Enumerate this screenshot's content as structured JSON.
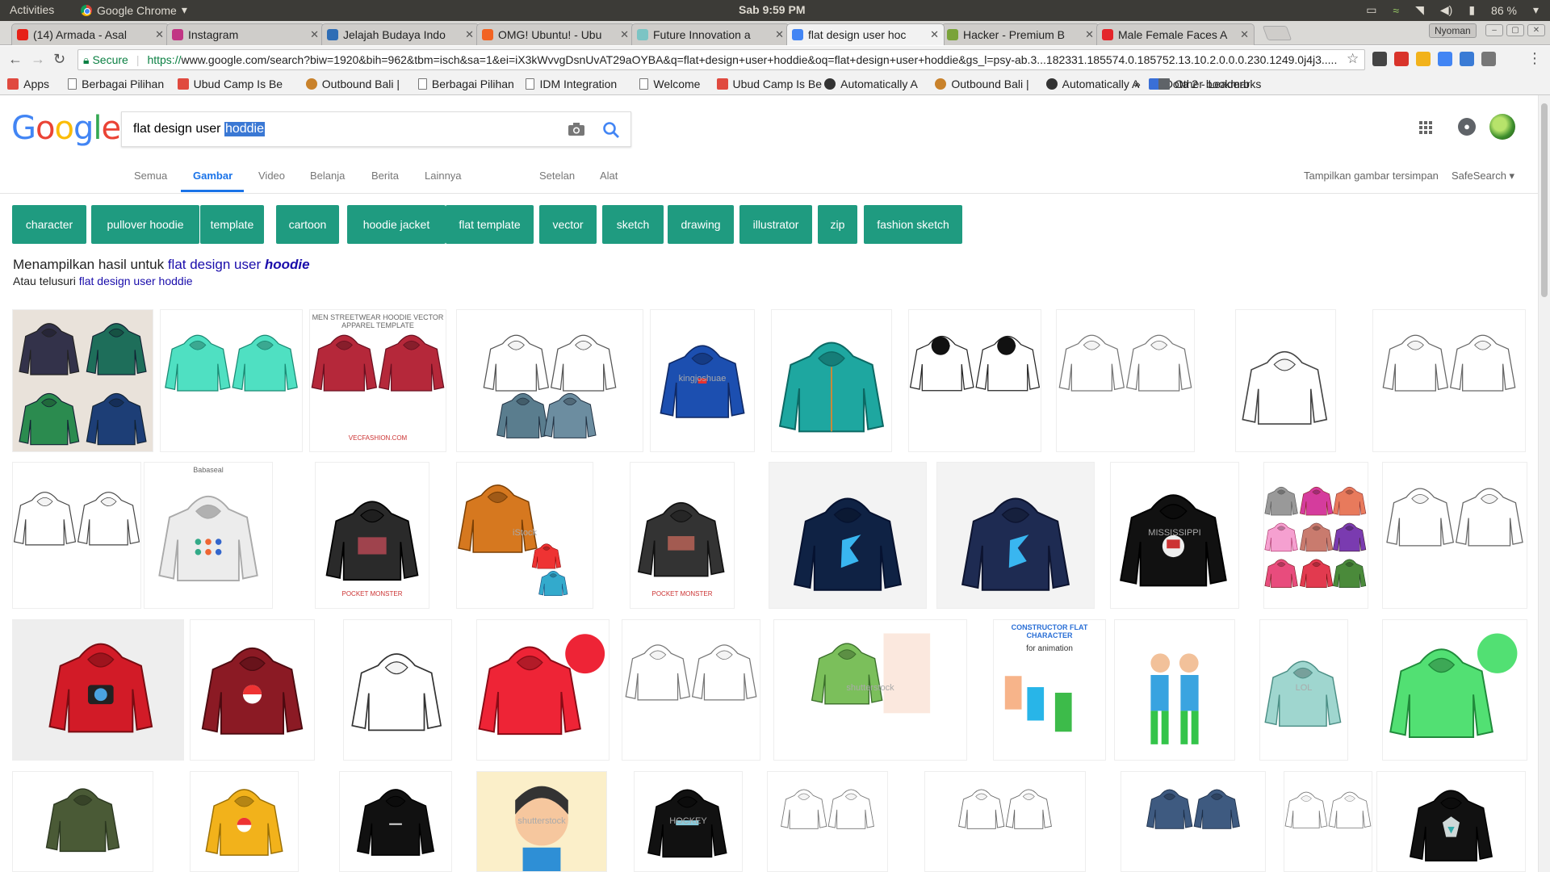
{
  "os_bar": {
    "activities": "Activities",
    "app_name": "Google Chrome",
    "clock": "Sab  9:59 PM",
    "battery": "86 %"
  },
  "tabs": [
    {
      "title": "(14) Armada - Asal",
      "fav_color": "#e62117",
      "icon": "youtube-icon"
    },
    {
      "title": "Instagram",
      "fav_color": "#c13584",
      "icon": "instagram-icon"
    },
    {
      "title": "Jelajah Budaya Indo",
      "fav_color": "#2f6db5",
      "icon": "wordpress-icon"
    },
    {
      "title": "OMG! Ubuntu! - Ubu",
      "fav_color": "#f26322",
      "icon": "omgubuntu-icon"
    },
    {
      "title": "Future Innovation a",
      "fav_color": "#7bc4c4",
      "icon": "spinner-icon"
    },
    {
      "title": "flat design user hoc",
      "fav_color": "#4285f4",
      "icon": "google-icon"
    },
    {
      "title": "Hacker - Premium B",
      "fav_color": "#7aa33a",
      "icon": "envato-icon"
    },
    {
      "title": "Male Female Faces A",
      "fav_color": "#e4252a",
      "icon": "shutterstock-icon"
    }
  ],
  "profile_name": "Nyoman",
  "address": {
    "secure_label": "Secure",
    "scheme": "https://",
    "url": "www.google.com/search?biw=1920&bih=962&tbm=isch&sa=1&ei=iX3kWvvgDsnUvAT29aOYBA&q=flat+design+user+hoddie&oq=flat+design+user+hoddie&gs_l=psy-ab.3...182331.185574.0.185752.13.10.2.0.0.0.230.1249.0j4j3....."
  },
  "bookmarks": [
    {
      "label": "Apps",
      "icon": "apps-icon"
    },
    {
      "label": "Berbagai Pilihan",
      "icon": "page-icon"
    },
    {
      "label": "Ubud Camp Is Be",
      "icon": "wifi-icon"
    },
    {
      "label": "Outbound Bali |",
      "icon": "gear-icon"
    },
    {
      "label": "Berbagai Pilihan",
      "icon": "page-icon"
    },
    {
      "label": "IDM Integration",
      "icon": "page-icon"
    },
    {
      "label": "Welcome",
      "icon": "page-icon"
    },
    {
      "label": "Ubud Camp Is Be",
      "icon": "wifi-icon"
    },
    {
      "label": "Automatically A",
      "icon": "circle-icon"
    },
    {
      "label": "Outbound Bali |",
      "icon": "gear-icon"
    },
    {
      "label": "Automatically A",
      "icon": "circle-icon"
    },
    {
      "label": "Dota 2 - Leaderb",
      "icon": "signal-icon"
    }
  ],
  "bookmarks_more": "»",
  "other_bookmarks": "Other bookmarks",
  "search": {
    "query_prefix": "flat design user ",
    "query_selected": "hoddie"
  },
  "gtabs": [
    "Semua",
    "Gambar",
    "Video",
    "Belanja",
    "Berita",
    "Lainnya",
    "Setelan",
    "Alat"
  ],
  "gtab_active": "Gambar",
  "right_links": {
    "saved": "Tampilkan gambar tersimpan",
    "safesearch": "SafeSearch ▾"
  },
  "chips": [
    "character",
    "pullover hoodie",
    "template",
    "cartoon",
    "hoodie jacket",
    "flat template",
    "vector",
    "sketch",
    "drawing",
    "illustrator",
    "zip",
    "fashion sketch"
  ],
  "result_info": {
    "prefix": "Menampilkan hasil untuk ",
    "corrected_plain": "flat design user ",
    "corrected_term": "hoodie",
    "alt_prefix": "Atau telusuri ",
    "alt_query": "flat design user hoddie"
  },
  "thumbnail_captions": {
    "vector_template": "MEN STREETWEAR HOODIE VECTOR APPAREL TEMPLATE",
    "vecfashion": "VECFASHION.COM",
    "kingjoshuae": "kingjoshuae",
    "babaseal": "Babaseal",
    "pocket_monster": "POCKET MONSTER",
    "mississippi": "MISSISSIPPI",
    "constructor_title": "CONSTRUCTOR FLAT CHARACTER",
    "constructor_sub": "for animation",
    "shutterstock": "shutterstock",
    "lol": "LOL",
    "hockey": "HOCKEY",
    "istock": "iStock"
  },
  "colors": {
    "chip_bg": "#1f9b80",
    "link": "#1a0dab",
    "tab_active": "#1a73e8"
  }
}
